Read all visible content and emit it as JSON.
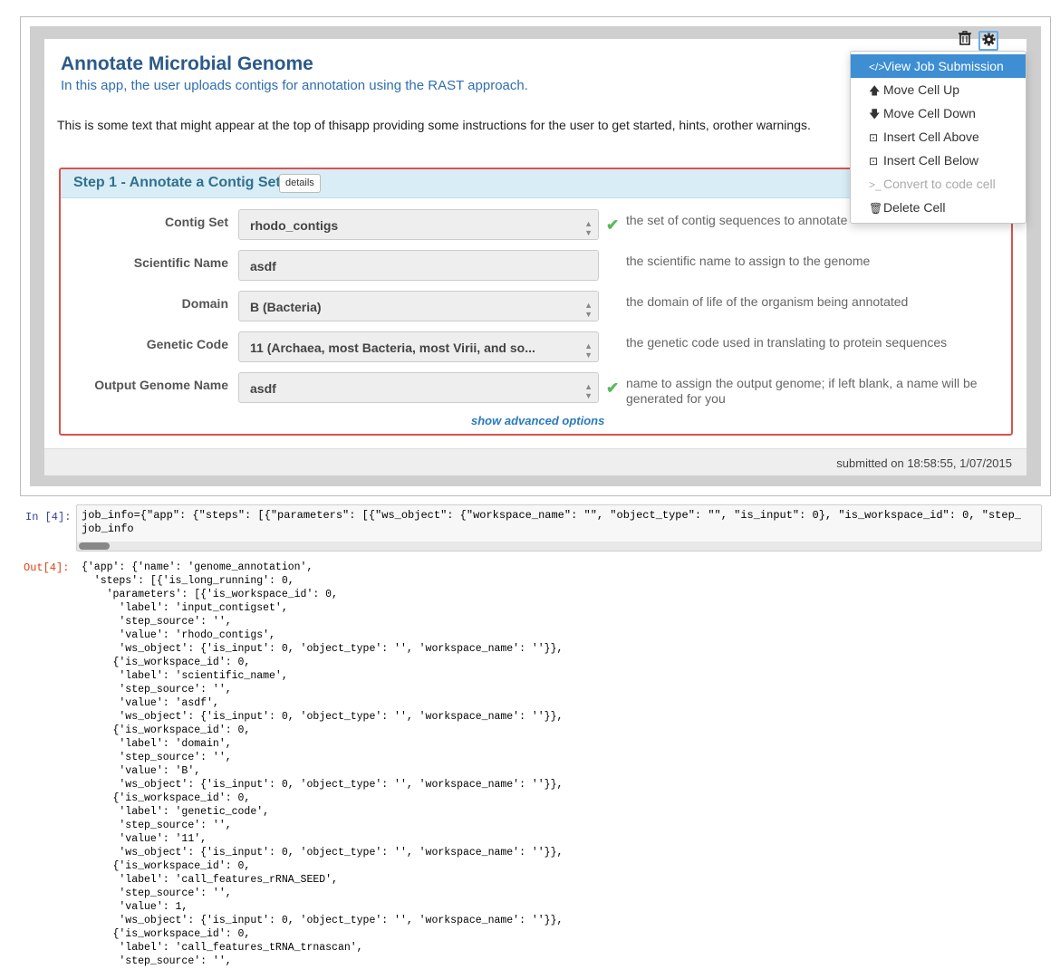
{
  "app": {
    "title": "Annotate Microbial Genome",
    "subtitle": "In this app, the user uploads contigs for annotation using the RAST approach.",
    "intro": "This is some text that might appear at the top of thisapp providing some instructions for the user to get started, hints, orother warnings."
  },
  "toolbar": {
    "trash_icon": "trash-icon",
    "gear_icon": "gear-icon"
  },
  "menu": {
    "items": [
      {
        "icon": "</>",
        "label": "View Job Submission",
        "state": "active"
      },
      {
        "icon": "🡅",
        "label": "Move Cell Up",
        "state": "normal"
      },
      {
        "icon": "🡇",
        "label": "Move Cell Down",
        "state": "normal"
      },
      {
        "icon": "⊡",
        "label": "Insert Cell Above",
        "state": "normal"
      },
      {
        "icon": "⊡",
        "label": "Insert Cell Below",
        "state": "normal"
      },
      {
        "icon": ">_",
        "label": "Convert to code cell",
        "state": "disabled"
      },
      {
        "icon": "🗑",
        "label": "Delete Cell",
        "state": "normal"
      }
    ]
  },
  "step": {
    "title": "Step 1 - Annotate a Contig Set",
    "details_label": "details",
    "advanced_link": "show advanced options",
    "params": [
      {
        "label": "Contig Set",
        "value": "rhodo_contigs",
        "dropdown": true,
        "checked": true,
        "hint": "the set of contig sequences to annotate"
      },
      {
        "label": "Scientific Name",
        "value": "asdf",
        "dropdown": false,
        "checked": false,
        "hint": "the scientific name to assign to the genome"
      },
      {
        "label": "Domain",
        "value": "B (Bacteria)",
        "dropdown": true,
        "checked": false,
        "hint": "the domain of life of the organism being annotated"
      },
      {
        "label": "Genetic Code",
        "value": "11 (Archaea, most Bacteria, most Virii, and so...",
        "dropdown": true,
        "checked": false,
        "hint": "the genetic code used in translating to protein sequences"
      },
      {
        "label": "Output Genome Name",
        "value": "asdf",
        "dropdown": true,
        "checked": true,
        "hint": "name to assign the output genome; if left blank, a name will be generated for you"
      }
    ]
  },
  "footer": {
    "submitted": "submitted on 18:58:55, 1/07/2015"
  },
  "code": {
    "prompt_in": "In [4]:",
    "prompt_out": "Out[4]:",
    "line1": "job_info={\"app\": {\"steps\": [{\"parameters\": [{\"ws_object\": {\"workspace_name\": \"\", \"object_type\": \"\", \"is_input\": 0}, \"is_workspace_id\": 0, \"step_",
    "line2": "job_info"
  },
  "output_lines": [
    "{'app': {'name': 'genome_annotation',",
    "  'steps': [{'is_long_running': 0,",
    "    'parameters': [{'is_workspace_id': 0,",
    "      'label': 'input_contigset',",
    "      'step_source': '',",
    "      'value': 'rhodo_contigs',",
    "      'ws_object': {'is_input': 0, 'object_type': '', 'workspace_name': ''}},",
    "     {'is_workspace_id': 0,",
    "      'label': 'scientific_name',",
    "      'step_source': '',",
    "      'value': 'asdf',",
    "      'ws_object': {'is_input': 0, 'object_type': '', 'workspace_name': ''}},",
    "     {'is_workspace_id': 0,",
    "      'label': 'domain',",
    "      'step_source': '',",
    "      'value': 'B',",
    "      'ws_object': {'is_input': 0, 'object_type': '', 'workspace_name': ''}},",
    "     {'is_workspace_id': 0,",
    "      'label': 'genetic_code',",
    "      'step_source': '',",
    "      'value': '11',",
    "      'ws_object': {'is_input': 0, 'object_type': '', 'workspace_name': ''}},",
    "     {'is_workspace_id': 0,",
    "      'label': 'call_features_rRNA_SEED',",
    "      'step_source': '',",
    "      'value': 1,",
    "      'ws_object': {'is_input': 0, 'object_type': '', 'workspace_name': ''}},",
    "     {'is_workspace_id': 0,",
    "      'label': 'call_features_tRNA_trnascan',",
    "      'step_source': '',"
  ]
}
